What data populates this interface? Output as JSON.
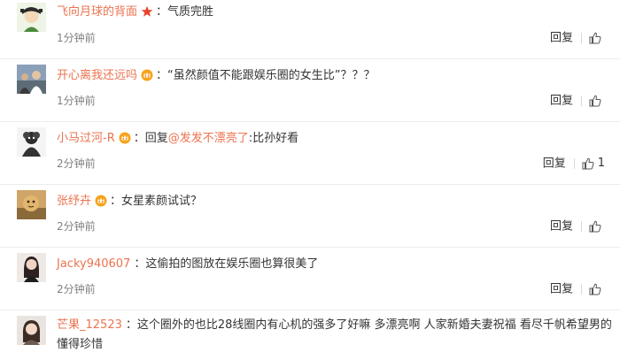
{
  "comments": [
    {
      "username": "飞向月球的背面",
      "badge": "red-star-icon",
      "separator": "：",
      "text": "气质完胜",
      "time": "1分钟前",
      "reply": "回复",
      "likes": ""
    },
    {
      "username": "开心离我还远吗",
      "badge": "crown-icon",
      "separator": "：",
      "text": "“虽然颜值不能跟娱乐圈的女生比”？？？",
      "time": "1分钟前",
      "reply": "回复",
      "likes": ""
    },
    {
      "username": "小马过河-R",
      "badge": "crown-icon",
      "separator": "：",
      "text_before": "回复",
      "mention": "@发发不漂亮了",
      "text": ":比孙好看",
      "time": "2分钟前",
      "reply": "回复",
      "likes": "1"
    },
    {
      "username": "张纾卉",
      "badge": "crown-icon",
      "separator": "：",
      "text": "女星素颜试试？",
      "time": "2分钟前",
      "reply": "回复",
      "likes": ""
    },
    {
      "username": "Jacky940607",
      "badge": "",
      "separator": "：",
      "text": "这偷拍的图放在娱乐圈也算很美了",
      "time": "2分钟前",
      "reply": "回复",
      "likes": ""
    },
    {
      "username": "芒果_12523",
      "badge": "",
      "separator": "：",
      "text": "这个圈外的也比28线圈内有心机的强多了好嘛 多漂亮啊 人家新婚夫妻祝福 看尽千帆希望男的懂得珍惜",
      "time": "",
      "reply": "",
      "likes": ""
    }
  ],
  "icons": {
    "like": "thumbs-up-icon"
  },
  "colors": {
    "username": "#eb7350",
    "text": "#333333",
    "time": "#808080"
  }
}
